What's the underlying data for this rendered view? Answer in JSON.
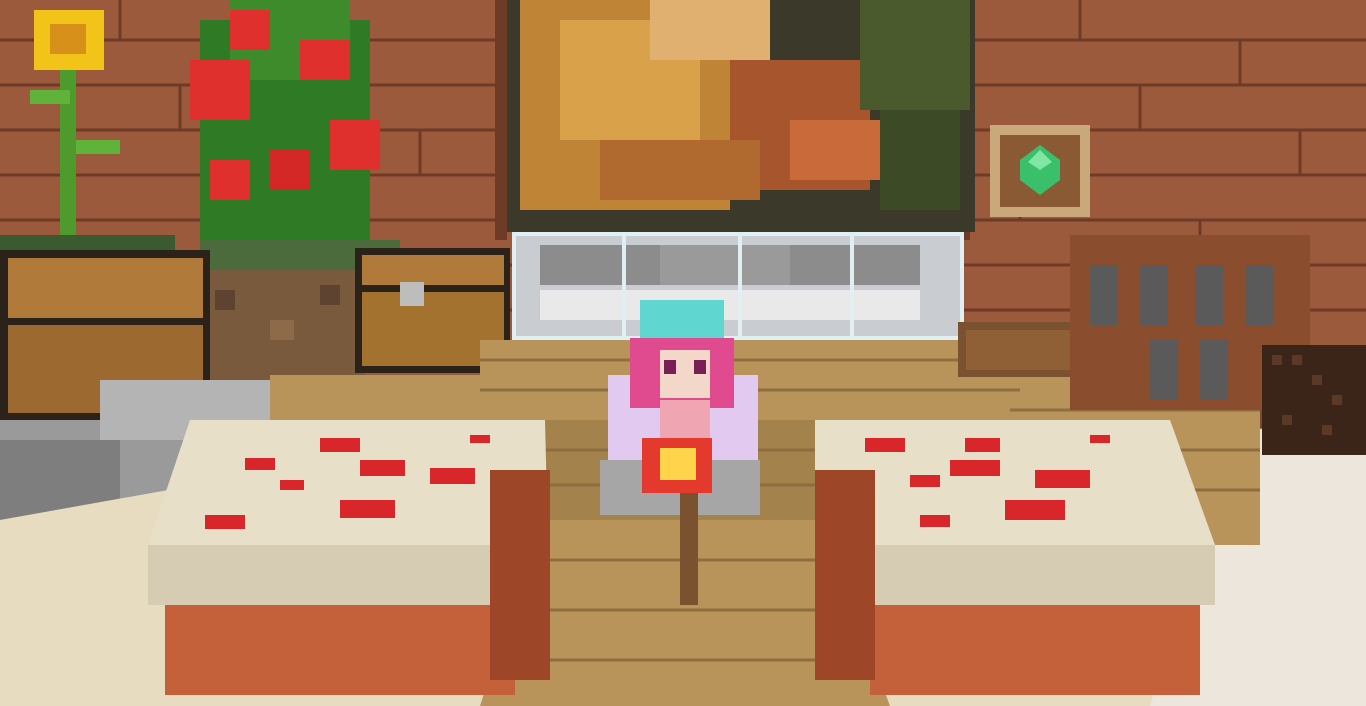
{
  "scene": {
    "objects": [
      {
        "id": "sunflower",
        "icon": "sunflower-icon"
      },
      {
        "id": "rose-bush",
        "icon": "rose-bush-icon"
      },
      {
        "id": "painting",
        "icon": "painting-icon"
      },
      {
        "id": "emerald-item-frame",
        "icon": "emerald-icon"
      },
      {
        "id": "chest-left",
        "icon": "chest-icon"
      },
      {
        "id": "chest-center",
        "icon": "chest-icon"
      },
      {
        "id": "glass-window",
        "icon": "glass-pane-icon"
      },
      {
        "id": "player-skin",
        "icon": "player-icon"
      },
      {
        "id": "redstone-torch",
        "icon": "redstone-torch-icon"
      },
      {
        "id": "cake-left",
        "icon": "cake-icon"
      },
      {
        "id": "cake-right",
        "icon": "cake-icon"
      },
      {
        "id": "spruce-fence-gate",
        "icon": "fence-gate-icon"
      },
      {
        "id": "note-block",
        "icon": "note-block-icon"
      }
    ],
    "colors": {
      "wall_planks": "#9c5a3c",
      "wall_plank_line": "#6e3b26",
      "oak_planks": "#b8935a",
      "oak_dark": "#8e6d3f",
      "cake_frosting": "#e8dfc8",
      "cake_sponge": "#c4613a",
      "cake_cherry": "#d8262b",
      "grass_green": "#3d8b2a",
      "rose_red": "#e0302d",
      "sunflower_yellow": "#f2c41a",
      "emerald": "#3ac06b",
      "player_hair": "#e04a8e",
      "player_hat": "#5fd6d0",
      "stone": "#8f8f8f",
      "floor_sand": "#e8dcc0"
    }
  }
}
